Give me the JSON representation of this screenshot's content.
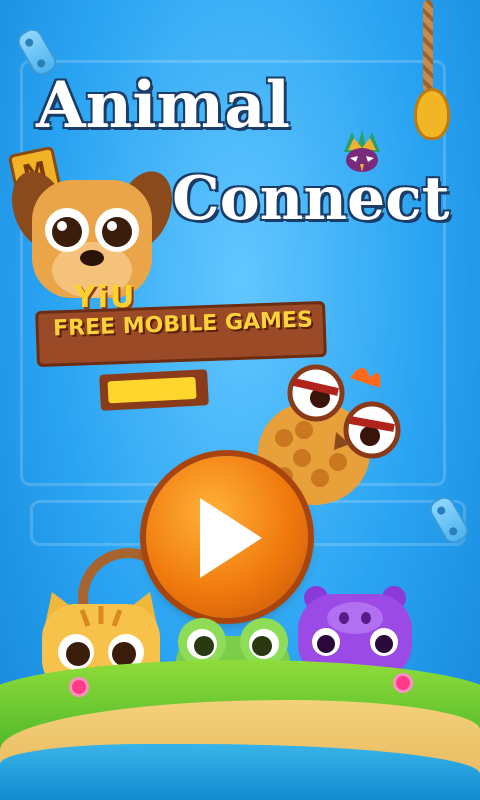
{
  "title": {
    "line1": "Animal",
    "line2": "Connect"
  },
  "badge": {
    "letter": "M"
  },
  "publisher": {
    "logo": "YiU",
    "tagline": "FREE MOBILE GAMES"
  },
  "play_button": {
    "label": "Play",
    "icon": "play-icon"
  },
  "colors": {
    "sky": "#2aa4f2",
    "play": "#f07a0c",
    "grass": "#4fb82a",
    "banner": "#9a4a26"
  }
}
